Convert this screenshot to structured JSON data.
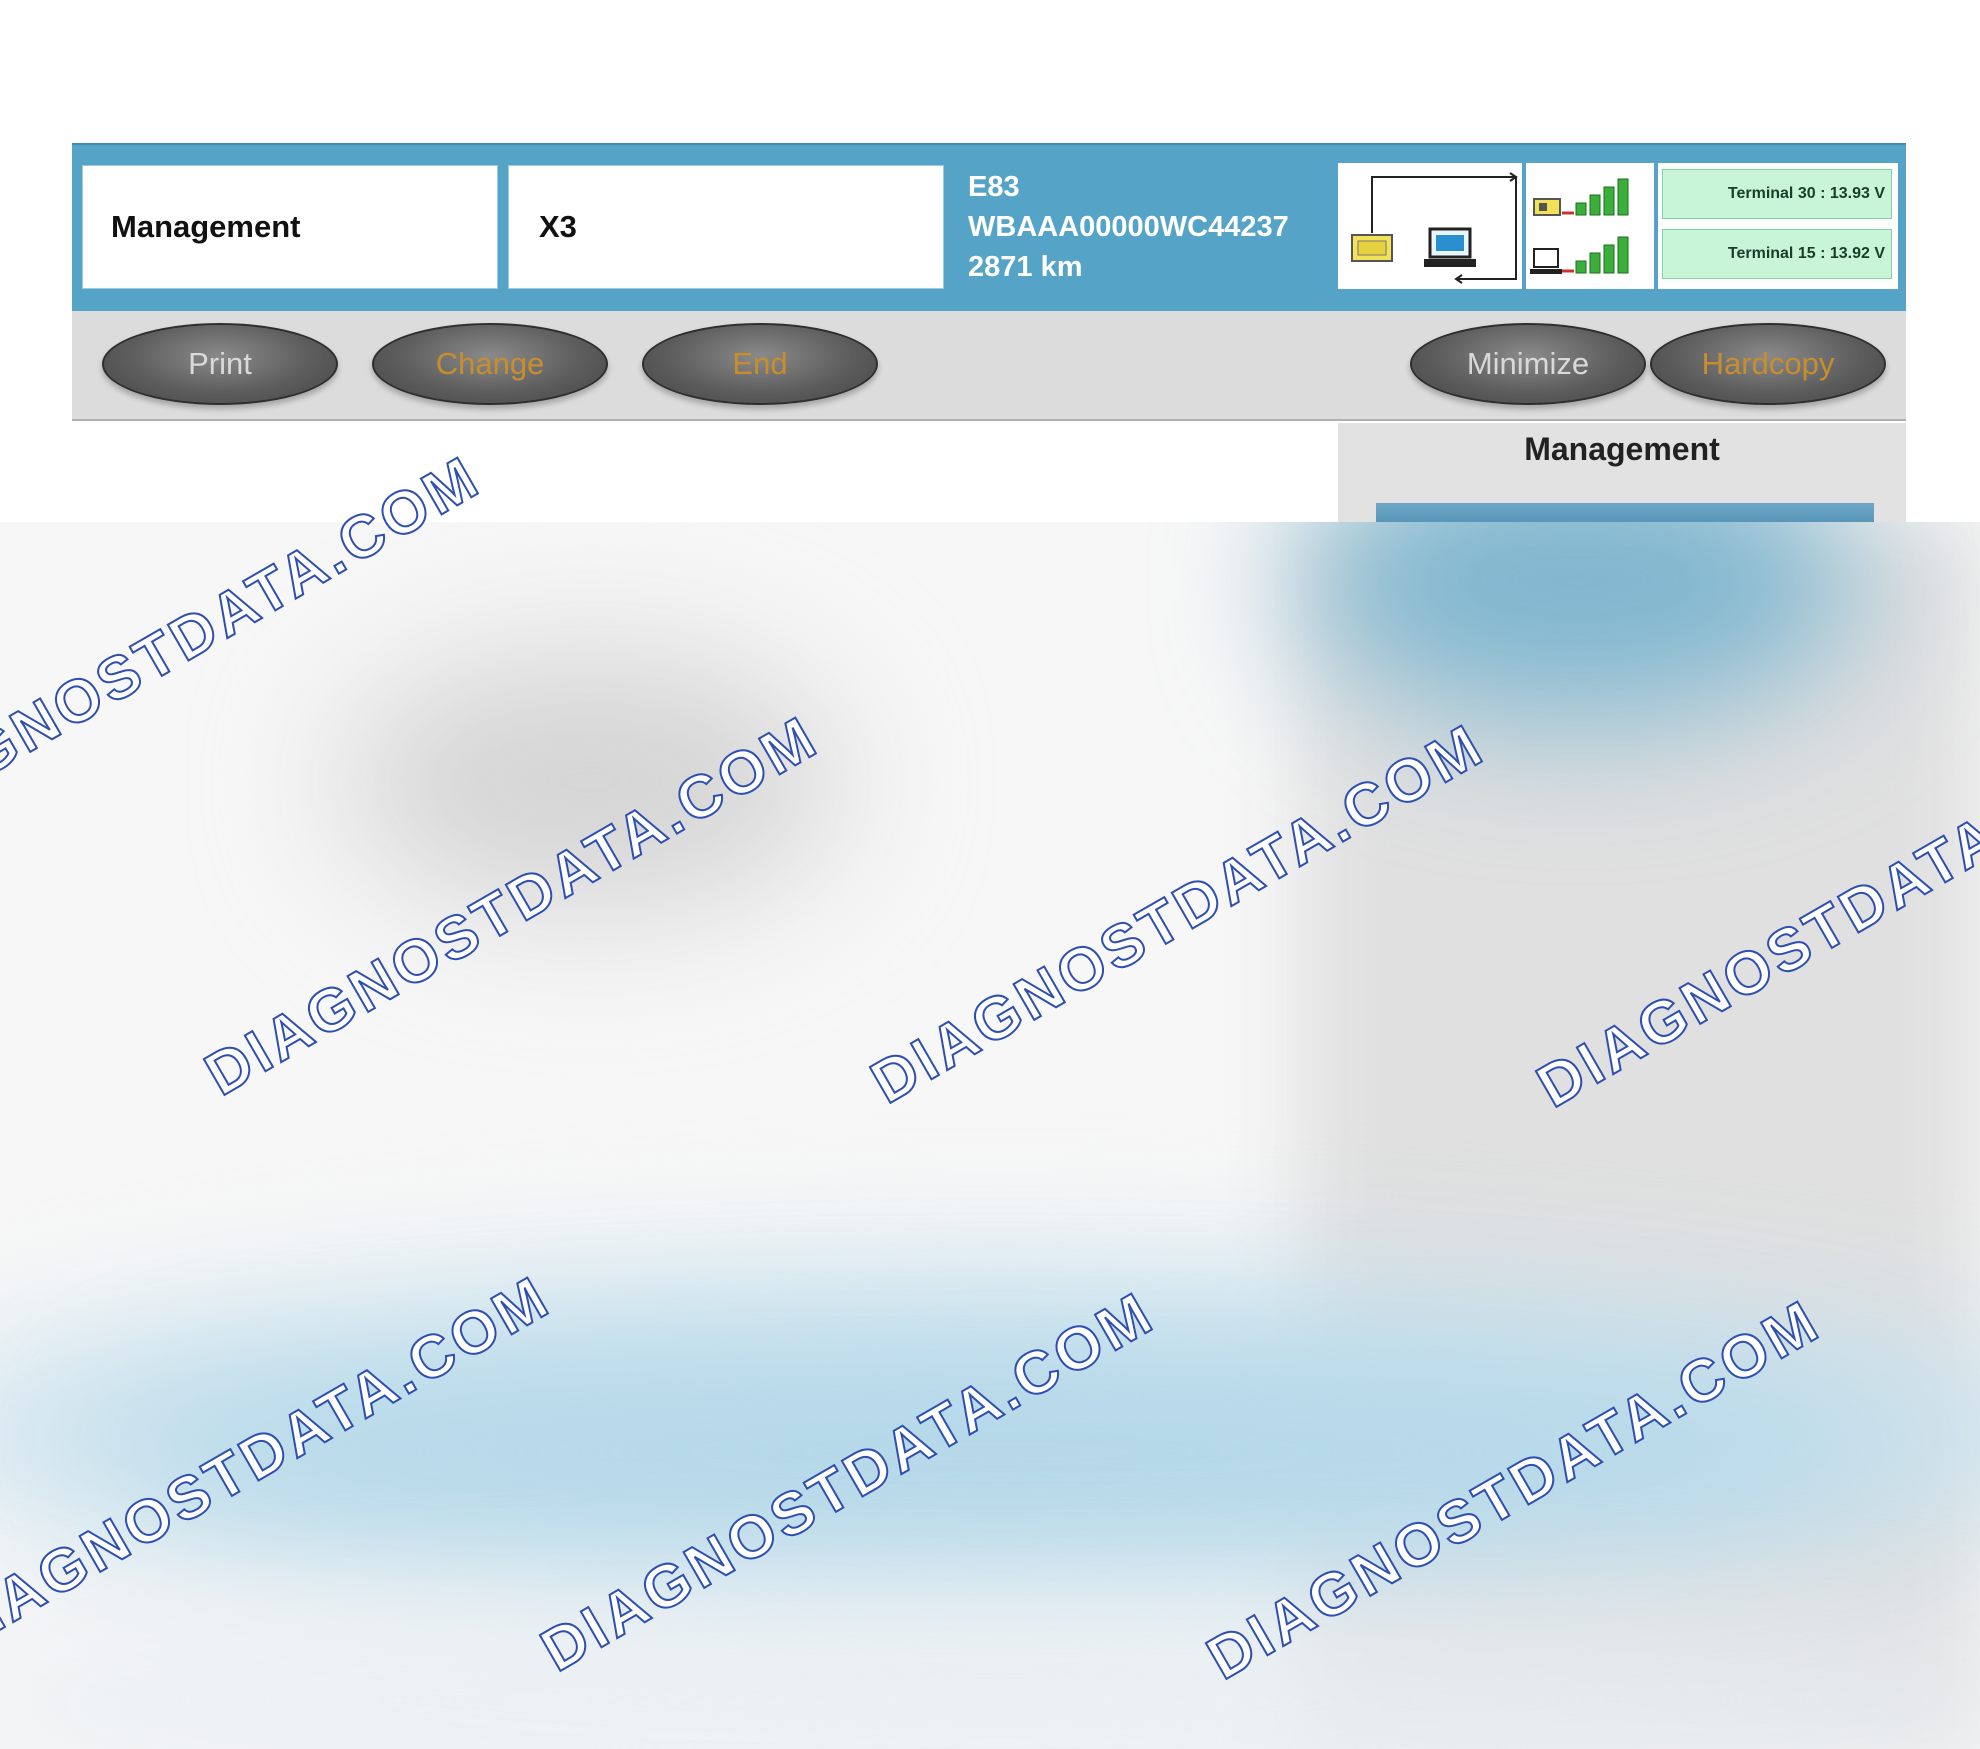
{
  "header": {
    "module_name": "Management",
    "model": "X3",
    "chassis": "E83",
    "vin": "WBAAA00000WC44237",
    "mileage": "2871 km",
    "terminal_30": "Terminal 30 : 13.93 V",
    "terminal_15": "Terminal 15 : 13.92 V"
  },
  "toolbar": {
    "print": "Print",
    "change": "Change",
    "end": "End",
    "minimize": "Minimize",
    "hardcopy": "Hardcopy"
  },
  "side_panel": {
    "title": "Management"
  },
  "watermark": {
    "text": "DIAGNOSTDATA.COM"
  },
  "colors": {
    "header_blue": "#55a4c8",
    "toolbar_gray": "#dcdcdc",
    "button_white_text": "#d9d9d9",
    "button_gold_text": "#c98e2c",
    "terminal_green": "#c8f5d8",
    "watermark_outline": "#2f4fb0"
  },
  "icons": [
    "interface-connector-icon",
    "laptop-icon",
    "signal-strength-icon"
  ]
}
